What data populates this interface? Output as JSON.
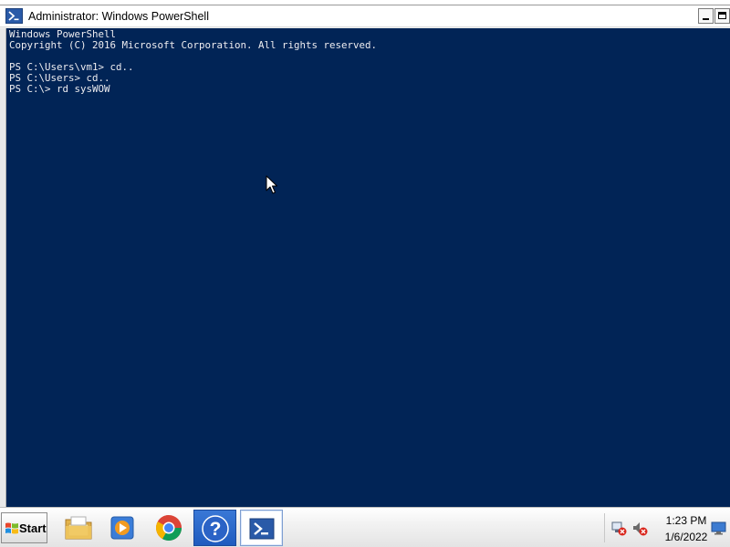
{
  "window": {
    "title": "Administrator: Windows PowerShell"
  },
  "console": {
    "lines": [
      "Windows PowerShell",
      "Copyright (C) 2016 Microsoft Corporation. All rights reserved.",
      "",
      "PS C:\\Users\\vm1> cd..",
      "PS C:\\Users> cd..",
      "PS C:\\> rd sysWOW"
    ],
    "background_color": "#012456",
    "text_color": "#eeedf0"
  },
  "taskbar": {
    "start_label": "Start",
    "pinned_apps": [
      {
        "name": "Windows Explorer",
        "icon": "folder-icon"
      },
      {
        "name": "Windows Media Player",
        "icon": "media-player-icon"
      },
      {
        "name": "Google Chrome",
        "icon": "chrome-icon"
      },
      {
        "name": "Help and Support",
        "icon": "help-icon",
        "active": true
      },
      {
        "name": "Windows PowerShell",
        "icon": "powershell-icon",
        "active": true
      }
    ],
    "tray": {
      "time": "1:23 PM",
      "date": "1/6/2022",
      "icons": [
        "network-disconnected-icon",
        "volume-muted-icon",
        "show-desktop-icon"
      ]
    }
  }
}
